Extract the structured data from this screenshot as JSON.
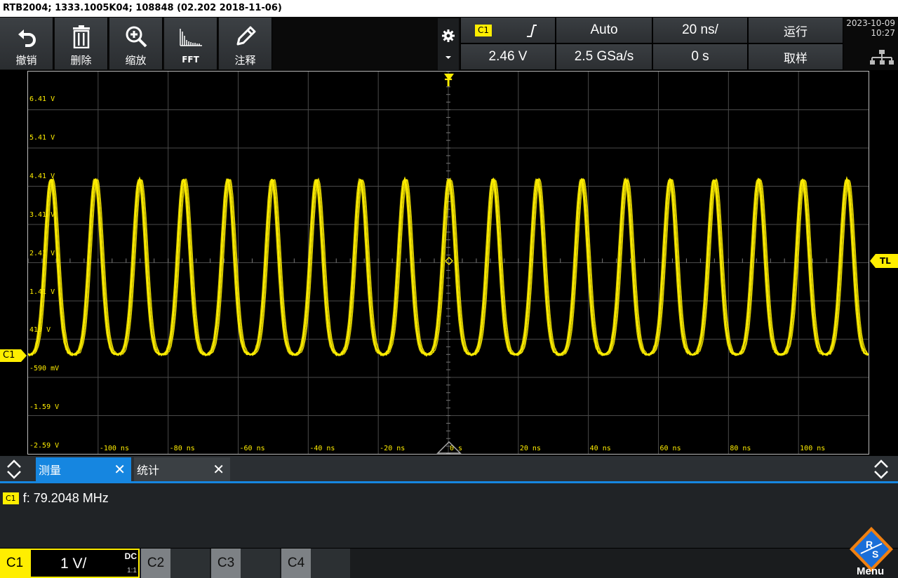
{
  "titlebar": {
    "text": "RTB2004; 1333.1005K04; 108848 (02.202 2018-11-06)"
  },
  "toolbar": {
    "undo": "撤销",
    "delete": "删除",
    "zoom": "缩放",
    "fft": "FFT",
    "annotate": "注释"
  },
  "header": {
    "trigger_source": "C1",
    "trigger_level": "2.46 V",
    "trigger_mode": "Auto",
    "sample_rate": "2.5 GSa/s",
    "timebase": "20 ns/",
    "time_offset": "0 s",
    "run_state": "运行",
    "acquire_mode": "取样"
  },
  "datetime": {
    "date": "2023-10-09",
    "time": "10:27"
  },
  "screen": {
    "y_labels": [
      "6.41 V",
      "5.41 V",
      "4.41 V",
      "3.41 V",
      "2.41 V",
      "1.41 V",
      "410 V",
      "-590 mV",
      "-1.59 V",
      "-2.59 V"
    ],
    "x_labels": [
      "-100 ns",
      "-80 ns",
      "-60 ns",
      "-40 ns",
      "-20 ns",
      "0 s",
      "20 ns",
      "40 ns",
      "60 ns",
      "80 ns",
      "100 ns"
    ],
    "channel_marker": "C1",
    "trigger_marker": "T",
    "trigger_level_marker": "TL",
    "trace_color": "#ffee00",
    "grid_color": "#4a4a4a"
  },
  "tabs": {
    "measure": "测量",
    "stats": "统计"
  },
  "measurement": {
    "channel": "C1",
    "text": "f: 79.2048 MHz"
  },
  "channels": {
    "c1": {
      "label": "C1",
      "scale": "1 V/",
      "coupling": "DC",
      "probe": "1:1"
    },
    "c2": {
      "label": "C2"
    },
    "c3": {
      "label": "C3"
    },
    "c4": {
      "label": "C4"
    }
  },
  "menu": {
    "label": "Menu"
  }
}
